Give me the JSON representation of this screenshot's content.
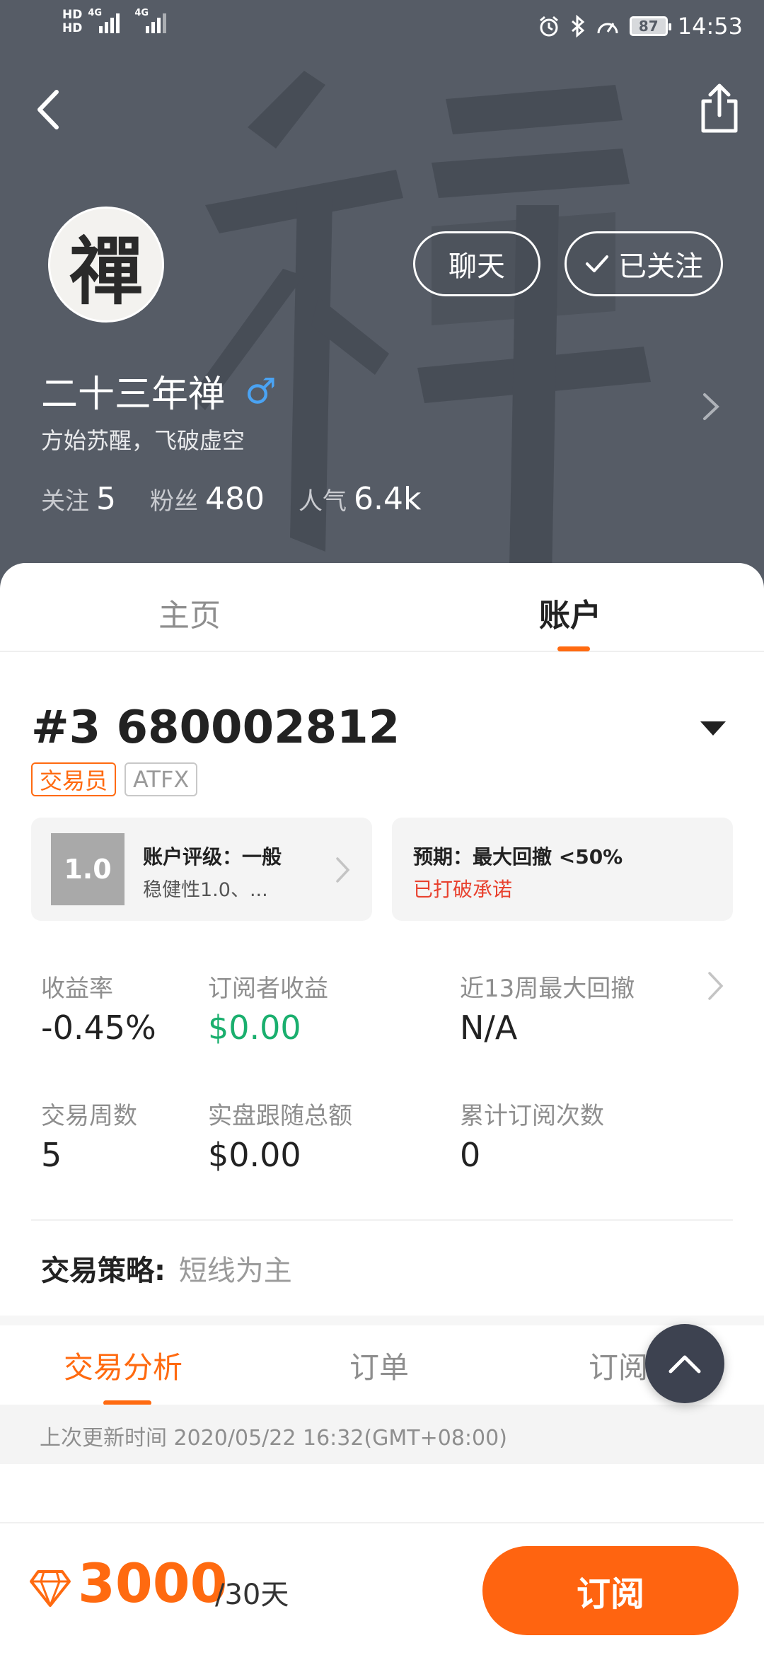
{
  "status_bar": {
    "hd_top": "HD",
    "hd_bottom": "HD",
    "net1": "4G",
    "net2": "4G",
    "battery": "87",
    "time": "14:53"
  },
  "profile": {
    "avatar_glyph": "禪",
    "name": "二十三年禅",
    "gender_symbol": "♂",
    "signature": "方始苏醒，飞破虚空",
    "chat_label": "聊天",
    "follow_label": "已关注",
    "stats": [
      {
        "label": "关注",
        "value": "5"
      },
      {
        "label": "粉丝",
        "value": "480"
      },
      {
        "label": "人气",
        "value": "6.4k"
      }
    ]
  },
  "main_tabs": [
    {
      "label": "主页",
      "active": false
    },
    {
      "label": "账户",
      "active": true
    }
  ],
  "account": {
    "title": "#3 680002812",
    "tags": [
      "交易员",
      "ATFX"
    ],
    "rating": {
      "score": "1.0",
      "title": "账户评级：一般",
      "subtitle": "稳健性1.0、..."
    },
    "expectation": {
      "title": "预期：最大回撤 <50%",
      "subtitle": "已打破承诺"
    },
    "metrics": [
      {
        "label": "收益率",
        "value": "-0.45%"
      },
      {
        "label": "订阅者收益",
        "value": "$0.00"
      },
      {
        "label": "近13周最大回撤",
        "value": "N/A"
      },
      {
        "label": "交易周数",
        "value": "5"
      },
      {
        "label": "实盘跟随总额",
        "value": "$0.00"
      },
      {
        "label": "累计订阅次数",
        "value": "0"
      }
    ],
    "strategy_label": "交易策略:",
    "strategy_value": "短线为主"
  },
  "sub_tabs": [
    {
      "label": "交易分析",
      "active": true
    },
    {
      "label": "订单",
      "active": false
    },
    {
      "label": "订阅者",
      "active": false
    }
  ],
  "update_text": "上次更新时间 2020/05/22 16:32(GMT+08:00)",
  "bottom": {
    "price": "3000",
    "period": "/30天",
    "subscribe_label": "订阅"
  },
  "colors": {
    "accent": "#ff6a10",
    "positive": "#1aaf6e",
    "warning": "#e8412e",
    "header_bg": "#565c66"
  }
}
